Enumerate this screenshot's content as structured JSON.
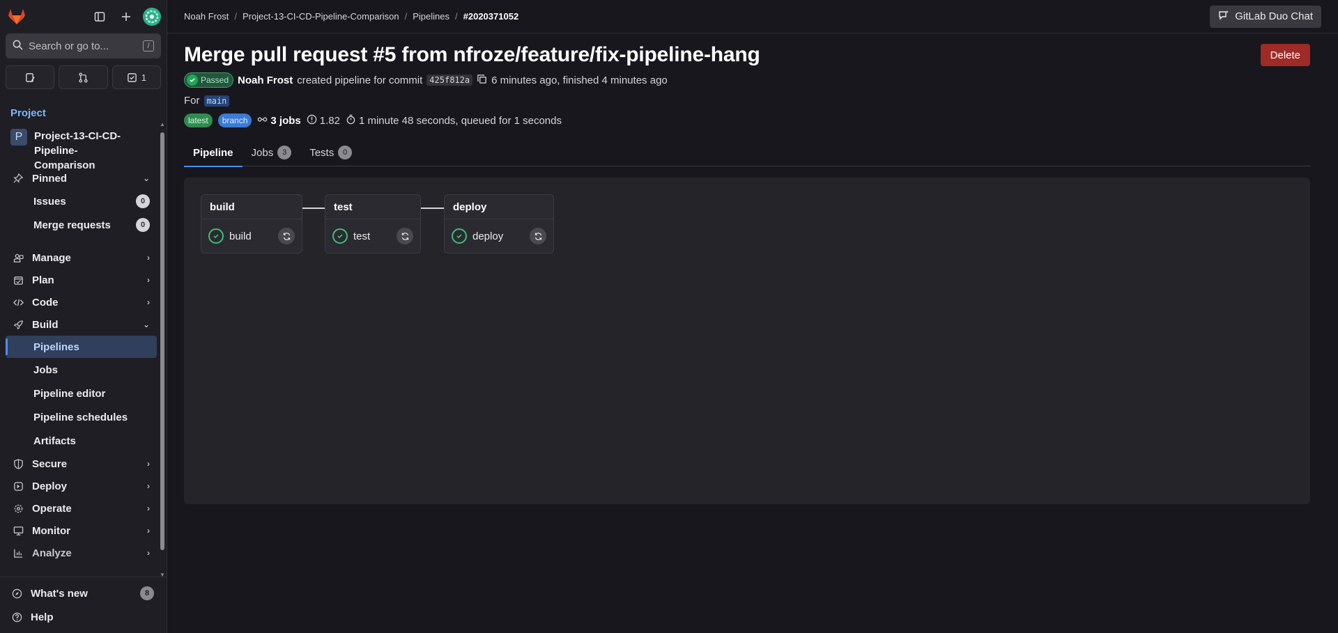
{
  "sidebar": {
    "search_placeholder": "Search or go to...",
    "search_kbd": "/",
    "quick_todo_count": "1",
    "section_label": "Project",
    "project": {
      "initial": "P",
      "name": "Project-13-CI-CD-Pipeline-Comparison"
    },
    "pinned": {
      "label": "Pinned",
      "items": [
        {
          "label": "Issues",
          "count": "0"
        },
        {
          "label": "Merge requests",
          "count": "0"
        }
      ]
    },
    "groups": [
      {
        "label": "Manage"
      },
      {
        "label": "Plan"
      },
      {
        "label": "Code"
      },
      {
        "label": "Build"
      }
    ],
    "build_items": [
      "Pipelines",
      "Jobs",
      "Pipeline editor",
      "Pipeline schedules",
      "Artifacts"
    ],
    "groups_after": [
      "Secure",
      "Deploy",
      "Operate",
      "Monitor",
      "Analyze"
    ],
    "bottom": {
      "whats_new": "What's new",
      "whats_new_count": "8",
      "help": "Help"
    }
  },
  "breadcrumb": {
    "items": [
      "Noah Frost",
      "Project-13-CI-CD-Pipeline-Comparison",
      "Pipelines"
    ],
    "current": "#2020371052"
  },
  "duo_chat_label": "GitLab Duo Chat",
  "page": {
    "title": "Merge pull request #5 from nfroze/feature/fix-pipeline-hang",
    "delete_label": "Delete",
    "status": "Passed",
    "author": "Noah Frost",
    "created_text": "created pipeline for commit",
    "commit": "425f812a",
    "time_text": "6 minutes ago, finished 4 minutes ago",
    "for_label": "For",
    "ref": "main",
    "tags": [
      "latest",
      "branch"
    ],
    "jobs_text": "3 jobs",
    "score": "1.82",
    "duration_text": "1 minute 48 seconds, queued for 1 seconds"
  },
  "tabs": [
    {
      "label": "Pipeline"
    },
    {
      "label": "Jobs",
      "count": "3"
    },
    {
      "label": "Tests",
      "count": "0"
    }
  ],
  "stages": [
    {
      "name": "build",
      "job": "build"
    },
    {
      "name": "test",
      "job": "test"
    },
    {
      "name": "deploy",
      "job": "deploy"
    }
  ],
  "colors": {
    "success": "#1aaa55",
    "accent": "#4a8fff",
    "danger": "#9e2b25"
  }
}
